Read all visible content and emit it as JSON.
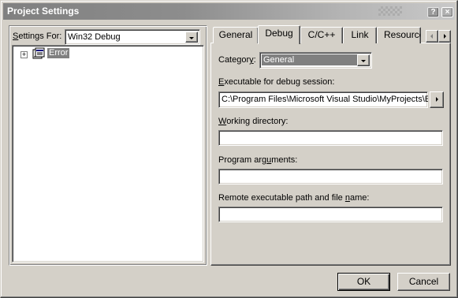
{
  "window": {
    "title": "Project Settings",
    "help_glyph": "?",
    "close_glyph": "×"
  },
  "left_panel": {
    "settings_for_label_prefix": "S",
    "settings_for_label_rest": "ettings For:",
    "settings_for_value": "Win32 Debug",
    "tree": {
      "expander": "+",
      "item_label": "Error",
      "item_icon": "project-icon"
    }
  },
  "tabs": [
    {
      "label": "General",
      "active": false
    },
    {
      "label": "Debug",
      "active": true
    },
    {
      "label": "C/C++",
      "active": false
    },
    {
      "label": "Link",
      "active": false
    },
    {
      "label": "Resource",
      "active": false
    }
  ],
  "debug": {
    "category_label_prefix": "Categor",
    "category_label_hot": "y",
    "category_label_suffix": ":",
    "category_value": "General",
    "exe_label_hot": "E",
    "exe_label_rest": "xecutable for debug session:",
    "exe_value": "C:\\Program Files\\Microsoft Visual Studio\\MyProjects\\E",
    "workdir_label_hot": "W",
    "workdir_label_rest": "orking directory:",
    "workdir_value": "",
    "args_label_prefix": "Program arg",
    "args_label_hot": "u",
    "args_label_rest": "ments:",
    "args_value": "",
    "remote_label_prefix": "Remote executable path and file ",
    "remote_label_hot": "n",
    "remote_label_rest": "ame:",
    "remote_value": ""
  },
  "buttons": {
    "ok": "OK",
    "cancel": "Cancel"
  },
  "colors": {
    "dialog_face": "#d4d0c8",
    "titlebar_inactive": "#808080",
    "selection_inactive": "#808080"
  }
}
